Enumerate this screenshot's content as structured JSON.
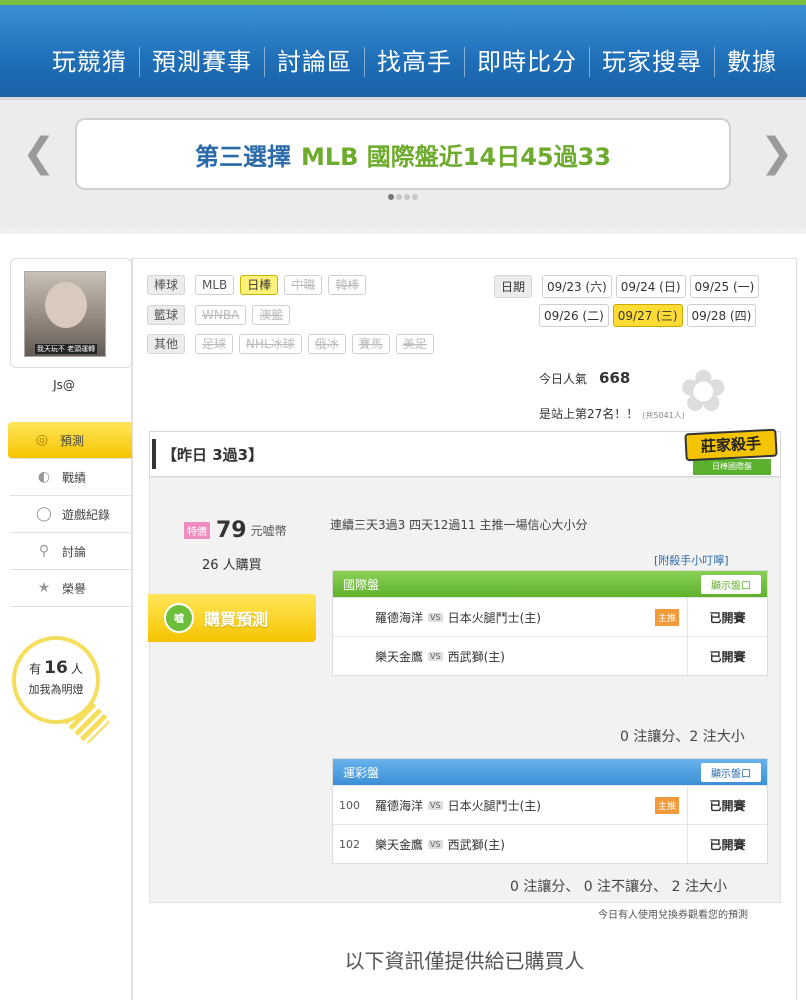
{
  "nav": [
    "玩競猜",
    "預測賽事",
    "討論區",
    "找高手",
    "即時比分",
    "玩家搜尋",
    "數據"
  ],
  "banner": {
    "part1": "第三選擇",
    "part2": "MLB 國際盤近14日45過33",
    "prev_icon": "chevron-left-icon",
    "next_icon": "chevron-right-icon"
  },
  "profile": {
    "username": "Js@",
    "avatar_caption": "我天玩不 老頭運轉"
  },
  "menu": [
    {
      "label": "預測",
      "icon": "target-icon"
    },
    {
      "label": "戰績",
      "icon": "chart-icon"
    },
    {
      "label": "遊戲紀錄",
      "icon": "record-icon"
    },
    {
      "label": "討論",
      "icon": "discussion-icon"
    },
    {
      "label": "榮譽",
      "icon": "medal-icon"
    }
  ],
  "bulb": {
    "prefix": "有",
    "count": "16",
    "suffix": "人",
    "line2": "加我為明燈"
  },
  "sports": {
    "baseball": {
      "label": "棒球",
      "items": [
        "MLB",
        "日棒",
        "中職",
        "韓棒"
      ]
    },
    "basketball": {
      "label": "籃球",
      "items": [
        "WNBA",
        "澳籃"
      ]
    },
    "other": {
      "label": "其他",
      "items": [
        "足球",
        "NHL冰球",
        "俄冰",
        "賽馬",
        "美足"
      ]
    }
  },
  "dates": {
    "label": "日期",
    "row1": [
      "09/23 (六)",
      "09/24 (日)",
      "09/25 (一)"
    ],
    "row2": [
      "09/26 (二)",
      "09/27 (三)",
      "09/28 (四)"
    ]
  },
  "popularity": {
    "label": "今日人氣",
    "value": "668",
    "rank": "是站上第27名！！",
    "total": "(共5041人)"
  },
  "yesterday": "【昨日 3過3】",
  "badge": {
    "title": "莊家殺手",
    "sub": "日棒國際盤"
  },
  "pred": {
    "special": "特價",
    "price": "79",
    "unit": "元嘘幣",
    "buyers": "26 人購買",
    "buy_label": "購買預測",
    "buy_icon_text": "嘘",
    "streak": "連續三天3過3 四天12過11 主推一場信心大小分",
    "tip": "[附殺手小叮嚀]"
  },
  "intl": {
    "title": "國際盤",
    "show": "顯示盤口",
    "rows": [
      {
        "num": "",
        "away": "羅德海洋",
        "home": "日本火腿鬥士(主)",
        "tag": "主推",
        "status": "已開賽"
      },
      {
        "num": "",
        "away": "樂天金鷹",
        "home": "西武獅(主)",
        "tag": "",
        "status": "已開賽"
      }
    ],
    "summary": "0 注讓分、2 注大小"
  },
  "lottery": {
    "title": "運彩盤",
    "show": "顯示盤口",
    "rows": [
      {
        "num": "100",
        "away": "羅德海洋",
        "home": "日本火腿鬥士(主)",
        "tag": "主推",
        "status": "已開賽"
      },
      {
        "num": "102",
        "away": "樂天金鷹",
        "home": "西武獅(主)",
        "tag": "",
        "status": "已開賽"
      }
    ],
    "summary": "0 注讓分、 0 注不讓分、 2 注大小",
    "note": "今日有人使用兌換券觀看您的預測"
  },
  "vs": "VS",
  "footer": "以下資訊僅提供給已購買人"
}
